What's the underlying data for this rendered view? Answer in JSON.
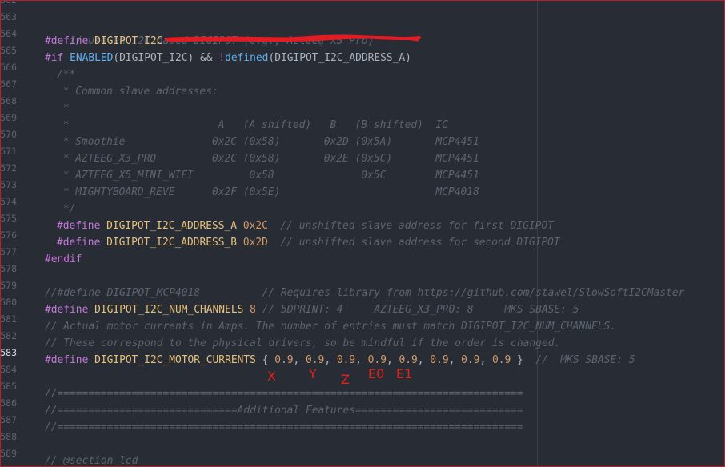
{
  "editor": {
    "gutter_lines": [
      "562",
      "563",
      "564",
      "565",
      "566",
      "567",
      "568",
      "569",
      "570",
      "571",
      "572",
      "573",
      "574",
      "575",
      "576",
      "577",
      "578",
      "579",
      "580",
      "581",
      "582",
      "583",
      "584",
      "585",
      "586",
      "587",
      "588",
      "589"
    ],
    "active_line": "583",
    "code": {
      "l563": "// Use an I2C based DIGIPOT (e.g., Azteeg X3 Pro)",
      "l564_kw": "#define",
      "l564_name": "DIGIPOT_I2C",
      "l565_if": "#if",
      "l565_enabled": "ENABLED",
      "l565_p1": "(DIGIPOT_I2C) ",
      "l565_and": "&&",
      "l565_not": " !",
      "l565_defined": "defined",
      "l565_p2": "(DIGIPOT_I2C_ADDRESS_A)",
      "l566": "/**",
      "l567": " * Common slave addresses:",
      "l568": " *",
      "l569": " *                        A   (A shifted)   B   (B shifted)  IC",
      "l570": " * Smoothie              0x2C (0x58)       0x2D (0x5A)       MCP4451",
      "l571": " * AZTEEG_X3_PRO         0x2C (0x58)       0x2E (0x5C)       MCP4451",
      "l572": " * AZTEEG_X5_MINI_WIFI         0x58              0x5C        MCP4451",
      "l573": " * MIGHTYBOARD_REVE      0x2F (0x5E)                         MCP4018",
      "l574": " */",
      "l575_kw": "#define",
      "l575_name": "DIGIPOT_I2C_ADDRESS_A",
      "l575_val": "0x2C",
      "l575_cm": "// unshifted slave address for first DIGIPOT",
      "l576_kw": "#define",
      "l576_name": "DIGIPOT_I2C_ADDRESS_B",
      "l576_val": "0x2D",
      "l576_cm": "// unshifted slave address for second DIGIPOT",
      "l577": "#endif",
      "l579": "//#define DIGIPOT_MCP4018          // Requires library from https://github.com/stawel/SlowSoftI2CMaster",
      "l580_kw": "#define",
      "l580_name": "DIGIPOT_I2C_NUM_CHANNELS",
      "l580_val": "8",
      "l580_cm": "// 5DPRINT: 4     AZTEEG_X3_PRO: 8     MKS SBASE: 5",
      "l581": "// Actual motor currents in Amps. The number of entries must match DIGIPOT_I2C_NUM_CHANNELS.",
      "l582": "// These correspond to the physical drivers, so be mindful if the order is changed.",
      "l583_kw": "#define",
      "l583_name": "DIGIPOT_I2C_MOTOR_CURRENTS",
      "l583_open": "{ ",
      "l583_values": [
        "0.9",
        "0.9",
        "0.9",
        "0.9",
        "0.9",
        "0.9",
        "0.9",
        "0.9"
      ],
      "l583_sep": ", ",
      "l583_close": " }",
      "l583_cm": "//  MKS SBASE: 5",
      "l585": "//===========================================================================",
      "l586": "//=============================Additional Features===========================",
      "l587": "//===========================================================================",
      "l589": "// @section lcd"
    }
  },
  "annotations": {
    "labels": [
      "X",
      "Y",
      "Z",
      "E0",
      "E1"
    ],
    "color": "#e0241c"
  },
  "colors": {
    "background": "#282c34",
    "comment": "#5c6370",
    "keyword": "#c678dd",
    "macro": "#e5c07b",
    "function": "#61afef",
    "number": "#d19a66",
    "border": "#b8202b"
  }
}
